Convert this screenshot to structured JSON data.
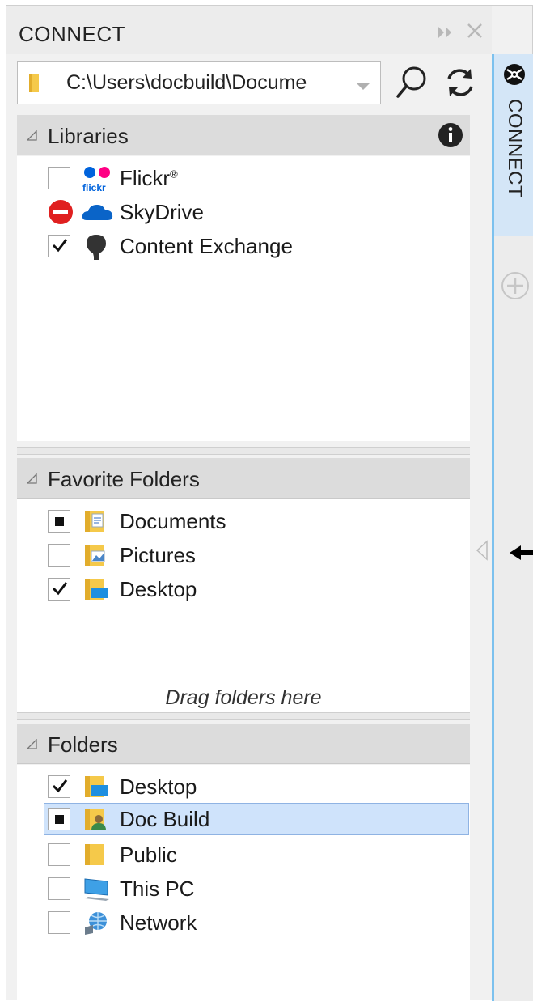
{
  "panel": {
    "title": "CONNECT",
    "path_value": "C:\\Users\\docbuild\\Documе",
    "side_tab_label": "CONNECT"
  },
  "libraries": {
    "header": "Libraries",
    "items": [
      {
        "label": "Flickr",
        "suffix": "®",
        "state": "unchecked",
        "icon": "flickr-icon"
      },
      {
        "label": "SkyDrive",
        "state": "blocked",
        "icon": "skydrive-cloud-icon"
      },
      {
        "label": "Content Exchange",
        "state": "checked",
        "icon": "content-exchange-bulb-icon"
      }
    ]
  },
  "favorites": {
    "header": "Favorite Folders",
    "items": [
      {
        "label": "Documents",
        "state": "partial",
        "icon": "documents-folder-icon"
      },
      {
        "label": "Pictures",
        "state": "unchecked",
        "icon": "pictures-folder-icon"
      },
      {
        "label": "Desktop",
        "state": "checked",
        "icon": "desktop-folder-icon"
      }
    ],
    "hint": "Drag folders here"
  },
  "folders": {
    "header": "Folders",
    "items": [
      {
        "label": "Desktop",
        "state": "checked",
        "icon": "desktop-folder-icon"
      },
      {
        "label": "Doc Build",
        "state": "partial",
        "icon": "user-folder-icon",
        "selected": true
      },
      {
        "label": "Public",
        "state": "unchecked",
        "icon": "folder-icon"
      },
      {
        "label": "This PC",
        "state": "unchecked",
        "icon": "computer-icon"
      },
      {
        "label": "Network",
        "state": "unchecked",
        "icon": "network-icon"
      }
    ]
  },
  "colors": {
    "accent": "#7cc1ee",
    "selection": "#cfe3fb",
    "blocked": "#e02020",
    "folder_yellow": "#f5c94a"
  }
}
